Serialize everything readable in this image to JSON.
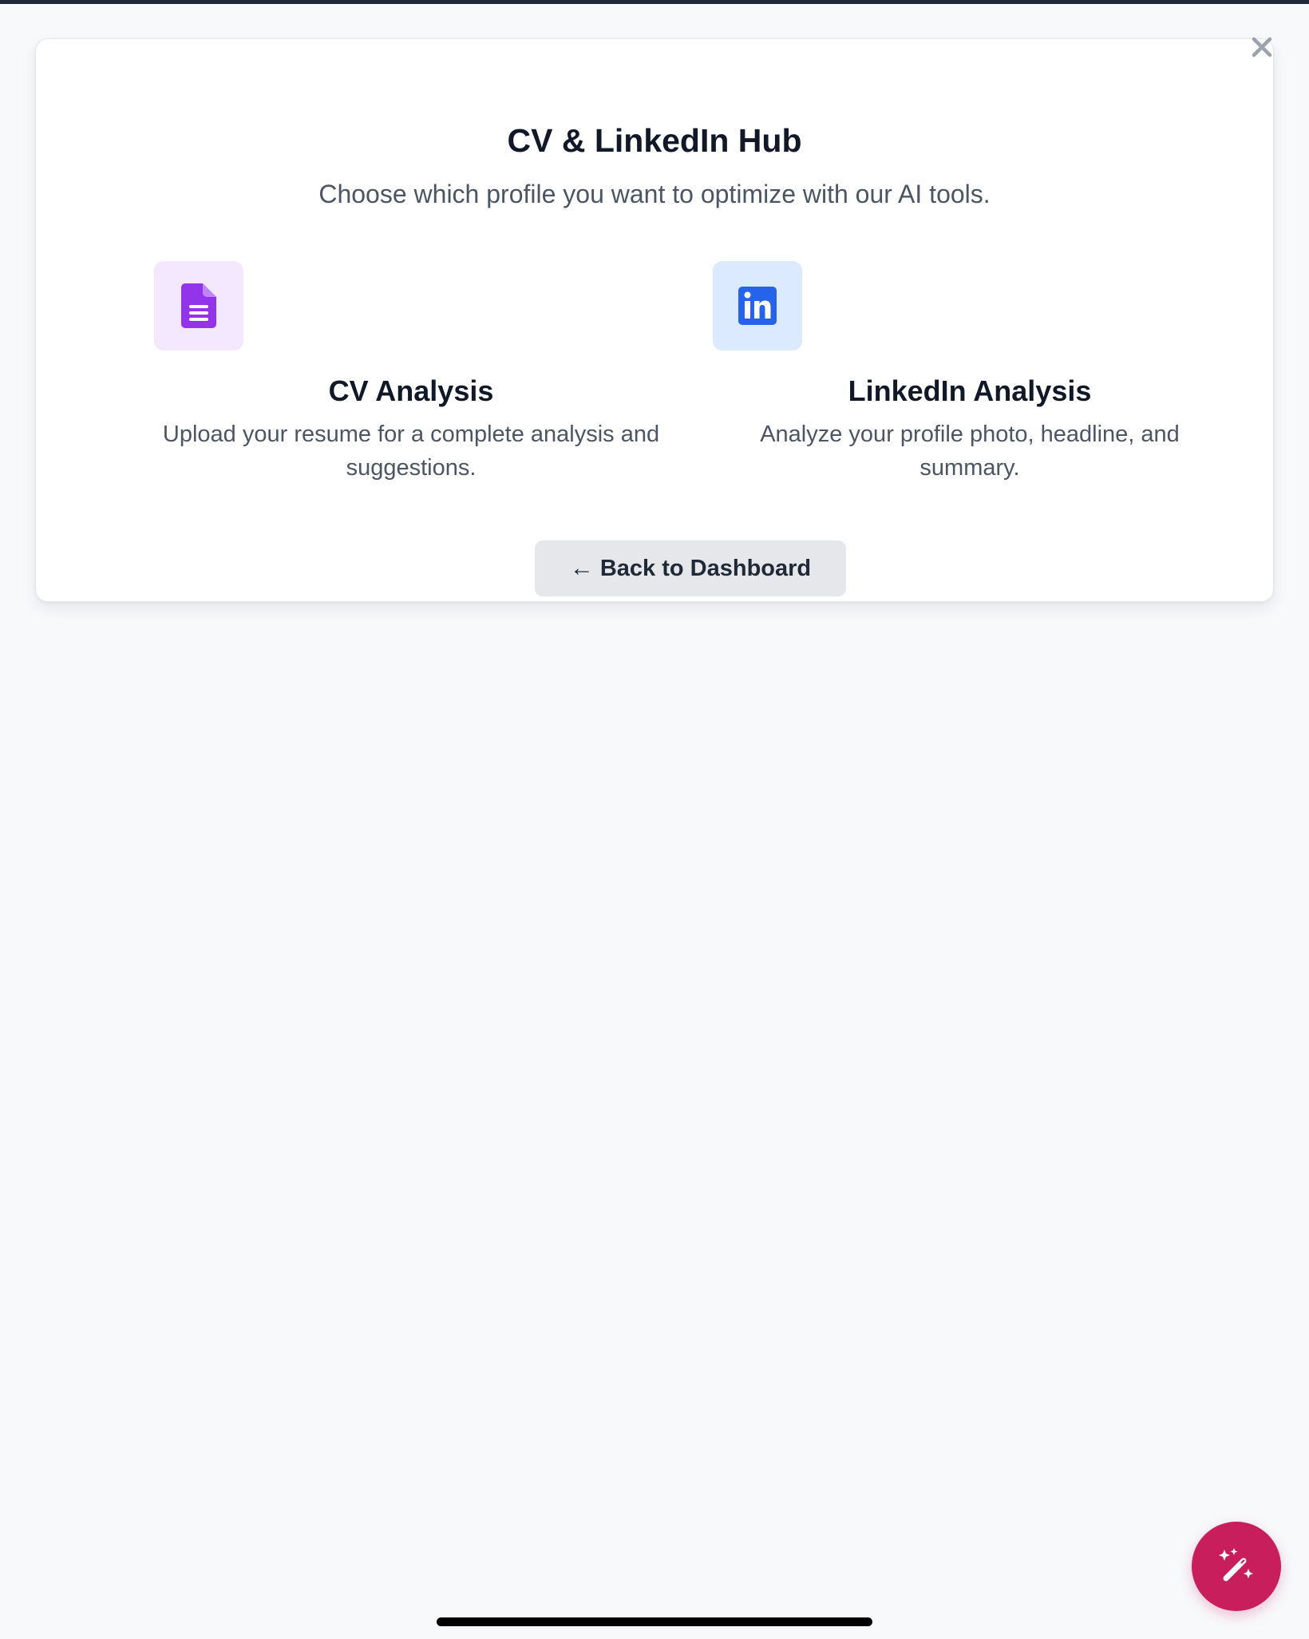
{
  "hub": {
    "title": "CV & LinkedIn Hub",
    "subtitle": "Choose which profile you want to optimize with our AI tools."
  },
  "options": [
    {
      "title": "CV Analysis",
      "description": "Upload your resume for a complete analysis and suggestions.",
      "icon": "document-icon",
      "tile_color": "#f3e8ff",
      "icon_color": "#9333ea"
    },
    {
      "title": "LinkedIn Analysis",
      "description": "Analyze your profile photo, headline, and summary.",
      "icon": "linkedin-icon",
      "tile_color": "#dbeafe",
      "icon_color": "#2563eb"
    }
  ],
  "back_button": {
    "arrow": "←",
    "label": "Back to Dashboard"
  },
  "icons": {
    "close": "close-icon",
    "fab": "magic-wand-icon"
  },
  "colors": {
    "fab": "#c81e5b",
    "background": "#f8f9fb"
  }
}
